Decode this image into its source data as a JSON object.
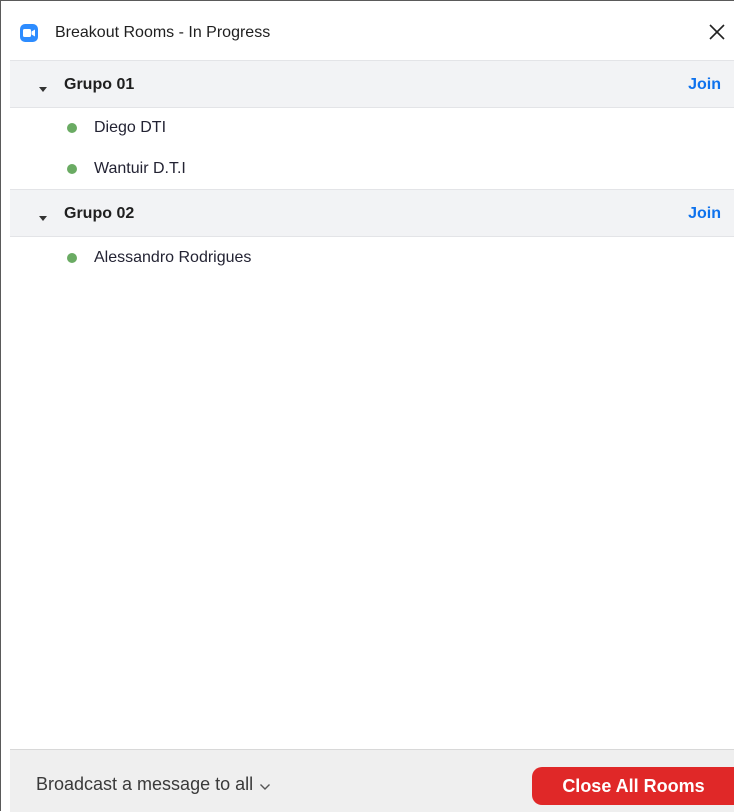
{
  "window": {
    "title": "Breakout Rooms - In Progress",
    "app_icon": "zoom-video-icon",
    "close_icon": "close-icon"
  },
  "groups": [
    {
      "name": "Grupo 01",
      "join_label": "Join",
      "expanded": true,
      "participants": [
        {
          "name": "Diego DTI",
          "status": "online"
        },
        {
          "name": "Wantuir D.T.I",
          "status": "online"
        }
      ]
    },
    {
      "name": "Grupo 02",
      "join_label": "Join",
      "expanded": true,
      "participants": [
        {
          "name": "Alessandro Rodrigues",
          "status": "online"
        }
      ]
    }
  ],
  "footer": {
    "broadcast_label": "Broadcast a message to all",
    "close_all_label": "Close All Rooms"
  },
  "colors": {
    "accent": "#2d8cff",
    "join_link": "#0e72ed",
    "online_dot": "#6aab63",
    "close_all_bg": "#e02828",
    "group_header_bg": "#f2f3f5",
    "footer_bg": "#efefef"
  }
}
